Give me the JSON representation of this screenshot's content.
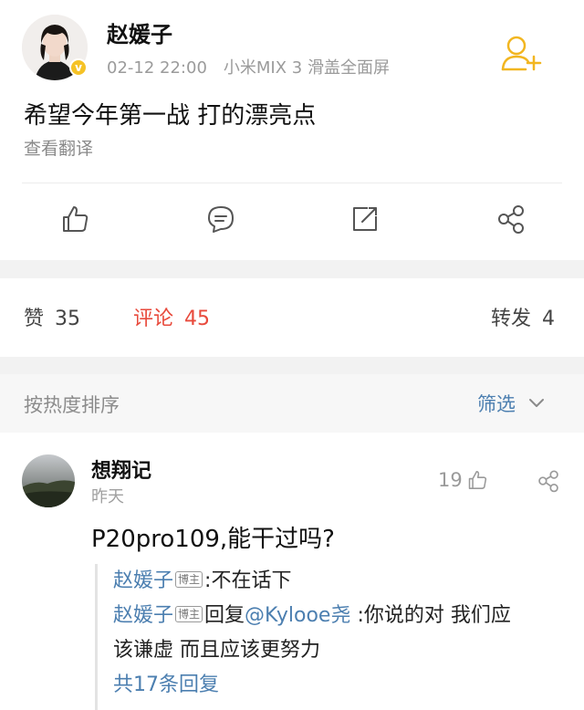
{
  "post": {
    "author": "赵媛子",
    "verified_badge": "v",
    "date": "02-12 22:00",
    "device": "小米MIX 3 滑盖全面屏",
    "text": "希望今年第一战 打的漂亮点",
    "translate_label": "查看翻译",
    "icons": [
      "like-icon",
      "comment-icon",
      "repost-icon",
      "share-icon",
      "follow-icon"
    ]
  },
  "stats": {
    "like_label": "赞",
    "like_count": "35",
    "comment_label": "评论",
    "comment_count": "45",
    "repost_label": "转发",
    "repost_count": "4"
  },
  "sort": {
    "label": "按热度排序",
    "filter_label": "筛选"
  },
  "comment": {
    "author": "想翔记",
    "time": "昨天",
    "like_count": "19",
    "text": "P20pro109,能干过吗?",
    "replies": [
      {
        "name": "赵媛子",
        "tag": "博主",
        "text": ":不在话下"
      },
      {
        "name": "赵媛子",
        "tag": "博主",
        "prefix": "回复",
        "mention": "@Kylooe尧",
        "text": " :你说的对 我们应",
        "text2": "该谦虚 而且应该更努力"
      }
    ],
    "more_replies": "共17条回复"
  },
  "colors": {
    "accent_red": "#e84a3c",
    "link_blue": "#4c7fb0",
    "follow_yellow": "#f2b620"
  }
}
